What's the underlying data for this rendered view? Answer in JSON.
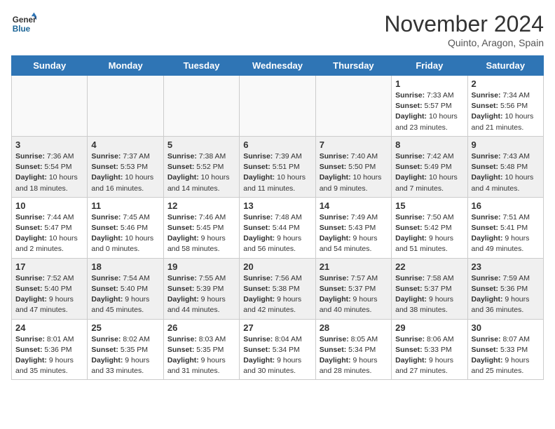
{
  "logo": {
    "line1": "General",
    "line2": "Blue"
  },
  "title": "November 2024",
  "subtitle": "Quinto, Aragon, Spain",
  "days_of_week": [
    "Sunday",
    "Monday",
    "Tuesday",
    "Wednesday",
    "Thursday",
    "Friday",
    "Saturday"
  ],
  "weeks": [
    [
      {
        "day": "",
        "info": ""
      },
      {
        "day": "",
        "info": ""
      },
      {
        "day": "",
        "info": ""
      },
      {
        "day": "",
        "info": ""
      },
      {
        "day": "",
        "info": ""
      },
      {
        "day": "1",
        "info": "Sunrise: 7:33 AM\nSunset: 5:57 PM\nDaylight: 10 hours and 23 minutes."
      },
      {
        "day": "2",
        "info": "Sunrise: 7:34 AM\nSunset: 5:56 PM\nDaylight: 10 hours and 21 minutes."
      }
    ],
    [
      {
        "day": "3",
        "info": "Sunrise: 7:36 AM\nSunset: 5:54 PM\nDaylight: 10 hours and 18 minutes."
      },
      {
        "day": "4",
        "info": "Sunrise: 7:37 AM\nSunset: 5:53 PM\nDaylight: 10 hours and 16 minutes."
      },
      {
        "day": "5",
        "info": "Sunrise: 7:38 AM\nSunset: 5:52 PM\nDaylight: 10 hours and 14 minutes."
      },
      {
        "day": "6",
        "info": "Sunrise: 7:39 AM\nSunset: 5:51 PM\nDaylight: 10 hours and 11 minutes."
      },
      {
        "day": "7",
        "info": "Sunrise: 7:40 AM\nSunset: 5:50 PM\nDaylight: 10 hours and 9 minutes."
      },
      {
        "day": "8",
        "info": "Sunrise: 7:42 AM\nSunset: 5:49 PM\nDaylight: 10 hours and 7 minutes."
      },
      {
        "day": "9",
        "info": "Sunrise: 7:43 AM\nSunset: 5:48 PM\nDaylight: 10 hours and 4 minutes."
      }
    ],
    [
      {
        "day": "10",
        "info": "Sunrise: 7:44 AM\nSunset: 5:47 PM\nDaylight: 10 hours and 2 minutes."
      },
      {
        "day": "11",
        "info": "Sunrise: 7:45 AM\nSunset: 5:46 PM\nDaylight: 10 hours and 0 minutes."
      },
      {
        "day": "12",
        "info": "Sunrise: 7:46 AM\nSunset: 5:45 PM\nDaylight: 9 hours and 58 minutes."
      },
      {
        "day": "13",
        "info": "Sunrise: 7:48 AM\nSunset: 5:44 PM\nDaylight: 9 hours and 56 minutes."
      },
      {
        "day": "14",
        "info": "Sunrise: 7:49 AM\nSunset: 5:43 PM\nDaylight: 9 hours and 54 minutes."
      },
      {
        "day": "15",
        "info": "Sunrise: 7:50 AM\nSunset: 5:42 PM\nDaylight: 9 hours and 51 minutes."
      },
      {
        "day": "16",
        "info": "Sunrise: 7:51 AM\nSunset: 5:41 PM\nDaylight: 9 hours and 49 minutes."
      }
    ],
    [
      {
        "day": "17",
        "info": "Sunrise: 7:52 AM\nSunset: 5:40 PM\nDaylight: 9 hours and 47 minutes."
      },
      {
        "day": "18",
        "info": "Sunrise: 7:54 AM\nSunset: 5:40 PM\nDaylight: 9 hours and 45 minutes."
      },
      {
        "day": "19",
        "info": "Sunrise: 7:55 AM\nSunset: 5:39 PM\nDaylight: 9 hours and 44 minutes."
      },
      {
        "day": "20",
        "info": "Sunrise: 7:56 AM\nSunset: 5:38 PM\nDaylight: 9 hours and 42 minutes."
      },
      {
        "day": "21",
        "info": "Sunrise: 7:57 AM\nSunset: 5:37 PM\nDaylight: 9 hours and 40 minutes."
      },
      {
        "day": "22",
        "info": "Sunrise: 7:58 AM\nSunset: 5:37 PM\nDaylight: 9 hours and 38 minutes."
      },
      {
        "day": "23",
        "info": "Sunrise: 7:59 AM\nSunset: 5:36 PM\nDaylight: 9 hours and 36 minutes."
      }
    ],
    [
      {
        "day": "24",
        "info": "Sunrise: 8:01 AM\nSunset: 5:36 PM\nDaylight: 9 hours and 35 minutes."
      },
      {
        "day": "25",
        "info": "Sunrise: 8:02 AM\nSunset: 5:35 PM\nDaylight: 9 hours and 33 minutes."
      },
      {
        "day": "26",
        "info": "Sunrise: 8:03 AM\nSunset: 5:35 PM\nDaylight: 9 hours and 31 minutes."
      },
      {
        "day": "27",
        "info": "Sunrise: 8:04 AM\nSunset: 5:34 PM\nDaylight: 9 hours and 30 minutes."
      },
      {
        "day": "28",
        "info": "Sunrise: 8:05 AM\nSunset: 5:34 PM\nDaylight: 9 hours and 28 minutes."
      },
      {
        "day": "29",
        "info": "Sunrise: 8:06 AM\nSunset: 5:33 PM\nDaylight: 9 hours and 27 minutes."
      },
      {
        "day": "30",
        "info": "Sunrise: 8:07 AM\nSunset: 5:33 PM\nDaylight: 9 hours and 25 minutes."
      }
    ]
  ]
}
